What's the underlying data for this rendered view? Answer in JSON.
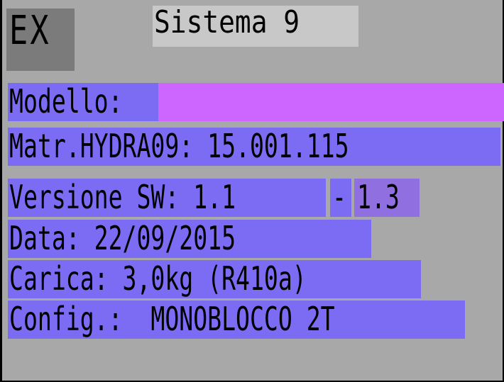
{
  "header": {
    "ex_label": "EX",
    "title": "Sistema 9"
  },
  "rows": {
    "modello": {
      "label": "Modello:",
      "value": ""
    },
    "matricola": {
      "text": "Matr.HYDRA09: 15.001.115"
    },
    "versione": {
      "label": "Versione SW: 1.1",
      "separator": "-",
      "value2": "1.3"
    },
    "data": {
      "text": "Data: 22/09/2015"
    },
    "carica": {
      "text": "Carica: 3,0kg (R410a)"
    },
    "config": {
      "text": "Config.:  MONOBLOCCO 2T"
    }
  },
  "colors": {
    "background": "#a8a8a8",
    "row_bar": "#7c6cf4",
    "modello_value_bar": "#cc66ff",
    "version_value_bar": "#9070e0"
  }
}
